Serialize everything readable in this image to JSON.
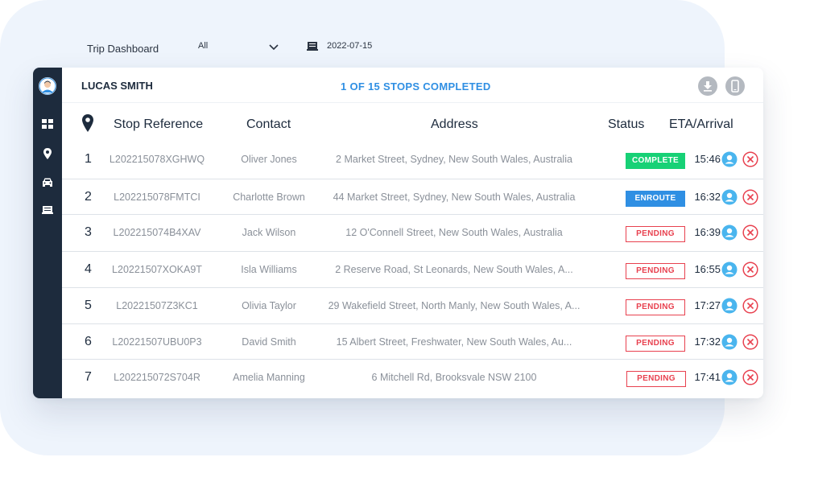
{
  "topbar": {
    "title": "Trip Dashboard",
    "filter_value": "All",
    "filter_icon": "chevron-down-icon",
    "date_icon": "calendar-icon",
    "date": "2022-07-15"
  },
  "sidebar": {
    "items": [
      {
        "name": "avatar",
        "icon": "user-avatar-icon"
      },
      {
        "name": "dashboard",
        "icon": "dashboard-icon"
      },
      {
        "name": "locations",
        "icon": "map-pin-icon"
      },
      {
        "name": "vehicles",
        "icon": "car-icon"
      },
      {
        "name": "trips",
        "icon": "truck-icon"
      }
    ]
  },
  "header": {
    "driver_name": "LUCAS SMITH",
    "stops_summary": "1 OF 15 STOPS COMPLETED",
    "buttons": [
      {
        "name": "download",
        "icon": "download-icon"
      },
      {
        "name": "mobile",
        "icon": "phone-icon"
      }
    ]
  },
  "table": {
    "columns": {
      "pin_icon": "map-pin-icon",
      "stop_reference": "Stop Reference",
      "contact": "Contact",
      "address": "Address",
      "status": "Status",
      "eta": "ETA/Arrival"
    },
    "rows": [
      {
        "num": "1",
        "ref": "L202215078XGHWQ",
        "contact": "Oliver Jones",
        "address": "2 Market Street, Sydney, New South Wales, Australia",
        "status": "COMPLETE",
        "status_type": "complete",
        "eta": "15:46"
      },
      {
        "num": "2",
        "ref": "L202215078FMTCI",
        "contact": "Charlotte Brown",
        "address": "44 Market Street, Sydney, New South Wales, Australia",
        "status": "ENROUTE",
        "status_type": "enroute",
        "eta": "16:32"
      },
      {
        "num": "3",
        "ref": "L202215074B4XAV",
        "contact": "Jack Wilson",
        "address": "12 O'Connell Street, New South Wales, Australia",
        "status": "PENDING",
        "status_type": "pending",
        "eta": "16:39"
      },
      {
        "num": "4",
        "ref": "L20221507XOKA9T",
        "contact": "Isla Williams",
        "address": "2 Reserve Road, St Leonards, New South Wales, A...",
        "status": "PENDING",
        "status_type": "pending",
        "eta": "16:55"
      },
      {
        "num": "5",
        "ref": "L20221507Z3KC1",
        "contact": "Olivia Taylor",
        "address": "29 Wakefield Street, North Manly, New South Wales, A...",
        "status": "PENDING",
        "status_type": "pending",
        "eta": "17:27"
      },
      {
        "num": "6",
        "ref": "L20221507UBU0P3",
        "contact": "David Smith",
        "address": "15 Albert Street, Freshwater, New South Wales, Au...",
        "status": "PENDING",
        "status_type": "pending",
        "eta": "17:32"
      },
      {
        "num": "7",
        "ref": "L202215072S704R",
        "contact": "Amelia Manning",
        "address": "6 Mitchell Rd, Brooksvale NSW 2100",
        "status": "PENDING",
        "status_type": "pending",
        "eta": "17:41"
      }
    ]
  },
  "colors": {
    "sidebar": "#1d2b3d",
    "accent_blue": "#2f8fe3",
    "complete_green": "#17d176",
    "pending_red": "#e8414f",
    "action_user_blue": "#4ab5ee"
  }
}
